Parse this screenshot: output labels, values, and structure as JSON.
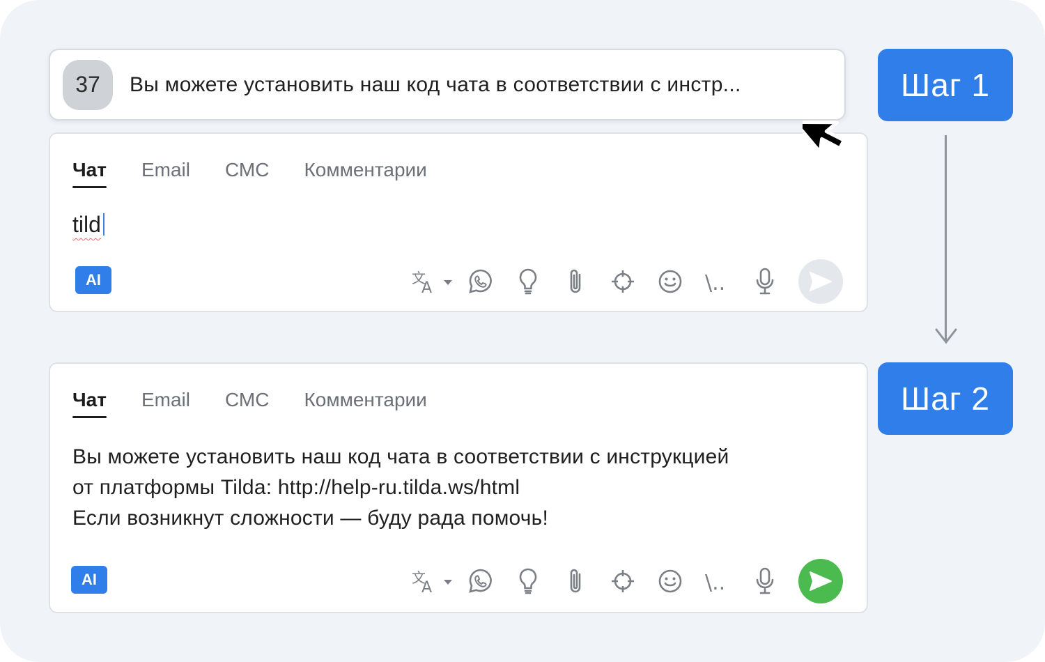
{
  "suggestion": {
    "count": "37",
    "text": "Вы можете установить наш код чата в соответствии с инстр..."
  },
  "tabs": [
    "Чат",
    "Email",
    "СМС",
    "Комментарии"
  ],
  "step1": {
    "label": "Шаг 1",
    "draft_text": "tild"
  },
  "step2": {
    "label": "Шаг 2",
    "message_lines": [
      "Вы можете установить наш код чата в соответствии с инструкцией",
      "от платформы Tilda: http://help-ru.tilda.ws/html",
      "Если возникнут сложности — буду рада помочь!"
    ]
  },
  "ai_label": "AI",
  "toolbar_icons": [
    "translate-icon",
    "whatsapp-icon",
    "lightbulb-icon",
    "paperclip-icon",
    "crosshair-icon",
    "smiley-icon",
    "templates-icon",
    "microphone-icon",
    "send-icon"
  ],
  "templates_glyph": "\\..",
  "colors": {
    "background": "#f0f4f8",
    "step_blue": "#2f7ee9",
    "send_active": "#4cbb4f",
    "send_disabled": "#e4e7eb"
  }
}
